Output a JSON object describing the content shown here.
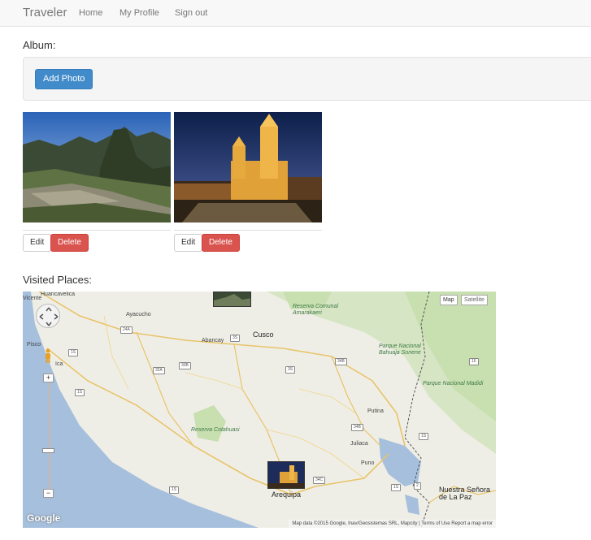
{
  "navbar": {
    "brand": "Traveler",
    "links": [
      "Home",
      "My Profile",
      "Sign out"
    ]
  },
  "album": {
    "title": "Album:",
    "add_photo_label": "Add Photo",
    "photos": [
      {
        "edit_label": "Edit",
        "delete_label": "Delete"
      },
      {
        "edit_label": "Edit",
        "delete_label": "Delete"
      }
    ]
  },
  "visited": {
    "title": "Visited Places:"
  },
  "map": {
    "map_type": [
      "Map",
      "Satellite"
    ],
    "zoom_in": "+",
    "zoom_out": "−",
    "logo": "Google",
    "attribution": "Map data ©2015 Google, Inav/Geosistemas SRL, Mapcity | Terms of Use    Report a map error",
    "places": [
      "Huancavelica",
      "Vicente",
      "Ayacucho",
      "Abancay",
      "Cusco",
      "Pisco",
      "Ica",
      "Puno",
      "Juliaca",
      "Putina",
      "Arequipa",
      "Nuestra Señora de La Paz"
    ],
    "parks": [
      "Reserva Comunal Amarakaeri",
      "Parque Nacional Bahuaja Sonene",
      "Parque Nacional Madidi",
      "Reserva Cotahuasi"
    ],
    "routes": [
      "24A",
      "1S",
      "30B",
      "32A",
      "3S",
      "34B",
      "3S",
      "1S",
      "34C",
      "34B",
      "1S",
      "2",
      "16",
      "1S",
      "1S"
    ]
  },
  "colors": {
    "primary": "#428bca",
    "danger": "#d9534f",
    "water": "#a5bfdd",
    "park": "#c8dfb0"
  }
}
